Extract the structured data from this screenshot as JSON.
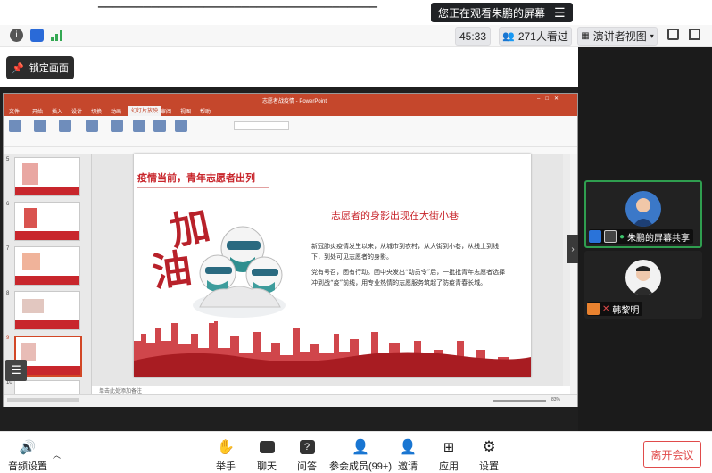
{
  "banner": {
    "viewing_text": "您正在观看朱鹏的屏幕",
    "menu_icon": "hamburger-icon"
  },
  "topbar": {
    "timer": "45:33",
    "viewer_count": "271人看过",
    "view_mode": "演讲者视图",
    "icons": [
      "info-icon",
      "shield-icon",
      "signal-icon",
      "people-icon",
      "grid-icon",
      "fullscreen-icon",
      "window-icon"
    ]
  },
  "share": {
    "lock_label": "锁定画面"
  },
  "ppt": {
    "window_title": "志愿者战疫情 - PowerPoint",
    "tabs": [
      "文件",
      "开始",
      "插入",
      "设计",
      "切换",
      "动画",
      "幻灯片放映",
      "审阅",
      "视图",
      "帮助"
    ],
    "active_tab_index": 6,
    "thumb_numbers": [
      "5",
      "6",
      "7",
      "8",
      "9",
      "10"
    ],
    "selected_thumb_index": 4,
    "notes_placeholder": "单击此处添加备注",
    "zoom": "83%"
  },
  "slide": {
    "title": "疫情当前，青年志愿者出列",
    "calligraphy_top": "加",
    "calligraphy_bottom": "油",
    "heading": "志愿者的身影出现在大街小巷",
    "para1": "新冠肺炎疫情发生以来，从城市到农村，从大街到小巷，从线上到线下，到处可见志愿者的身影。",
    "para2": "党有号召，团有行动。团中央发出“动员令”后，一批批青年志愿者选择冲到战“疫”前线，用专业热情的志愿服务筑起了防疫青春长城。"
  },
  "tiles": [
    {
      "name": "朱鹏的屏幕共享",
      "active": true
    },
    {
      "name": "韩黎明",
      "active": false
    }
  ],
  "bottombar": {
    "audio": "音频设置",
    "hand": "举手",
    "chat": "聊天",
    "qa": "问答",
    "members": "参会成员(99+)",
    "invite": "邀请",
    "apps": "应用",
    "settings": "设置",
    "leave": "离开会议"
  },
  "colors": {
    "ppt_red": "#c5472c",
    "slide_red": "#c8262c",
    "accent_green": "#2f9e4f",
    "leave_red": "#e04b4b"
  }
}
